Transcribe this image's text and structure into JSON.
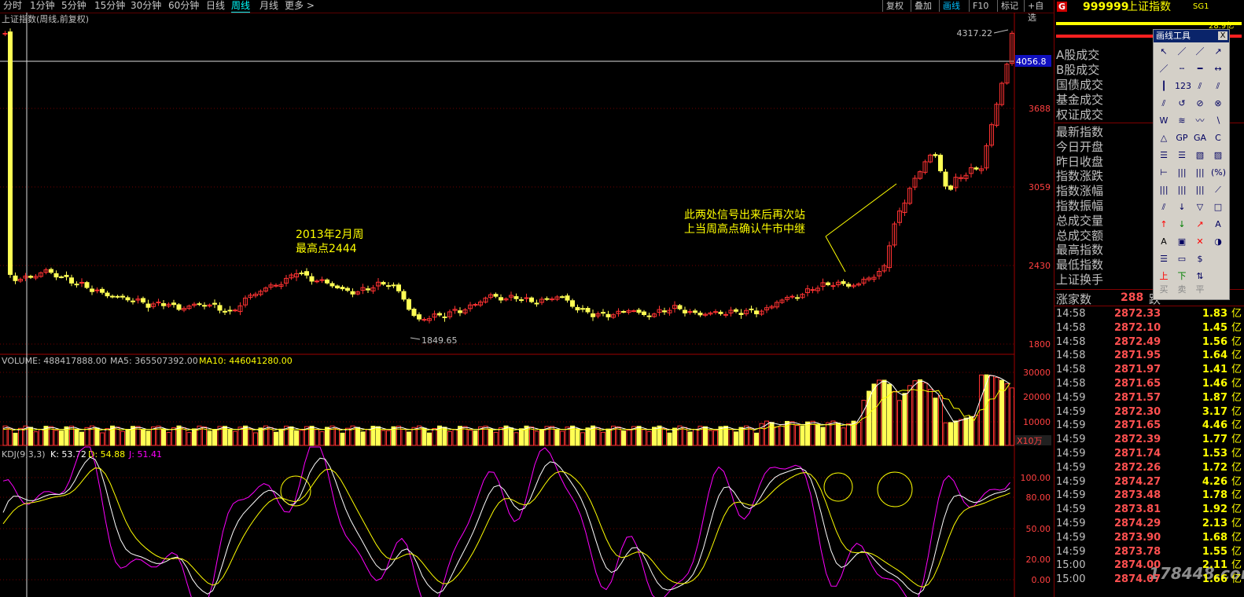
{
  "toolbar": {
    "items": [
      "分时",
      "1分钟",
      "5分钟",
      "15分钟",
      "30分钟",
      "60分钟",
      "日线",
      "周线",
      "月线",
      "更多 >"
    ],
    "active": "周线",
    "right_items": [
      "复权",
      "叠加",
      "画线",
      "F10",
      "标记",
      "+自选"
    ],
    "right_active": "画线"
  },
  "chart": {
    "title": "上证指数(周线,前复权)",
    "price_axis": [
      "3688",
      "3059",
      "2430",
      "1800"
    ],
    "current_price_label": "4056.8",
    "high_label": "4317.22",
    "low_label": "1849.65",
    "annotation1": [
      "2013年2月周",
      "最高点2444"
    ],
    "annotation2": [
      "此两处信号出来后再次站",
      "上当周高点确认牛市中继"
    ],
    "volume_header": {
      "vol": "VOLUME: 488417888.00",
      "ma5": "MA5: 365507392.00",
      "ma10": "MA10: 446041280.00"
    },
    "volume_axis": [
      "30000",
      "20000",
      "10000"
    ],
    "volume_unit": "X10万",
    "kdj_header": {
      "name": "KDJ(9,3,3)",
      "k": "K: 53.72",
      "d": "D: 54.88",
      "j": "J: 51.41"
    },
    "kdj_axis": [
      "100.00",
      "80.00",
      "50.00",
      "20.00",
      "0.00"
    ]
  },
  "colors": {
    "up": "#ff3232",
    "down": "#ffff54",
    "k": "#ffffff",
    "d": "#ffff00",
    "j": "#ff00ff",
    "annotation": "#ffff00"
  },
  "panel": {
    "badge": "G",
    "code": "999999",
    "name": "上证指数",
    "tag": "SG1",
    "small_value": "28.9亿",
    "fields_a": [
      "A股成交",
      "B股成交",
      "国债成交",
      "基金成交",
      "权证成交"
    ],
    "fields_b": [
      "最新指数",
      "今日开盘",
      "昨日收盘",
      "指数涨跌",
      "指数涨幅",
      "指数振幅",
      "总成交量",
      "总成交额",
      "最高指数",
      "最低指数",
      "上证换手"
    ],
    "advance_label": "涨家数",
    "advance_value": "288",
    "decline_label": "跌",
    "tools_title": "画线工具",
    "tools_close": "X",
    "tools_bottom": [
      "买",
      "卖",
      "平"
    ]
  },
  "ticks": [
    {
      "time": "14:58",
      "price": "2872.33",
      "vol": "1.83"
    },
    {
      "time": "14:58",
      "price": "2872.10",
      "vol": "1.45"
    },
    {
      "time": "14:58",
      "price": "2872.49",
      "vol": "1.56"
    },
    {
      "time": "14:58",
      "price": "2871.95",
      "vol": "1.64"
    },
    {
      "time": "14:58",
      "price": "2871.97",
      "vol": "1.41"
    },
    {
      "time": "14:58",
      "price": "2871.65",
      "vol": "1.46"
    },
    {
      "time": "14:59",
      "price": "2871.57",
      "vol": "1.87"
    },
    {
      "time": "14:59",
      "price": "2872.30",
      "vol": "3.17"
    },
    {
      "time": "14:59",
      "price": "2871.65",
      "vol": "4.46"
    },
    {
      "time": "14:59",
      "price": "2872.39",
      "vol": "1.77"
    },
    {
      "time": "14:59",
      "price": "2871.74",
      "vol": "1.53"
    },
    {
      "time": "14:59",
      "price": "2872.26",
      "vol": "1.72"
    },
    {
      "time": "14:59",
      "price": "2874.27",
      "vol": "4.26"
    },
    {
      "time": "14:59",
      "price": "2873.48",
      "vol": "1.78"
    },
    {
      "time": "14:59",
      "price": "2873.81",
      "vol": "1.92"
    },
    {
      "time": "14:59",
      "price": "2874.29",
      "vol": "2.13"
    },
    {
      "time": "14:59",
      "price": "2873.90",
      "vol": "1.68"
    },
    {
      "time": "14:59",
      "price": "2873.78",
      "vol": "1.55"
    },
    {
      "time": "15:00",
      "price": "2874.00",
      "vol": "2.11"
    },
    {
      "time": "15:00",
      "price": "2874.07",
      "vol": "1.66"
    }
  ],
  "tick_unit": "亿",
  "watermark": "178448.com"
}
